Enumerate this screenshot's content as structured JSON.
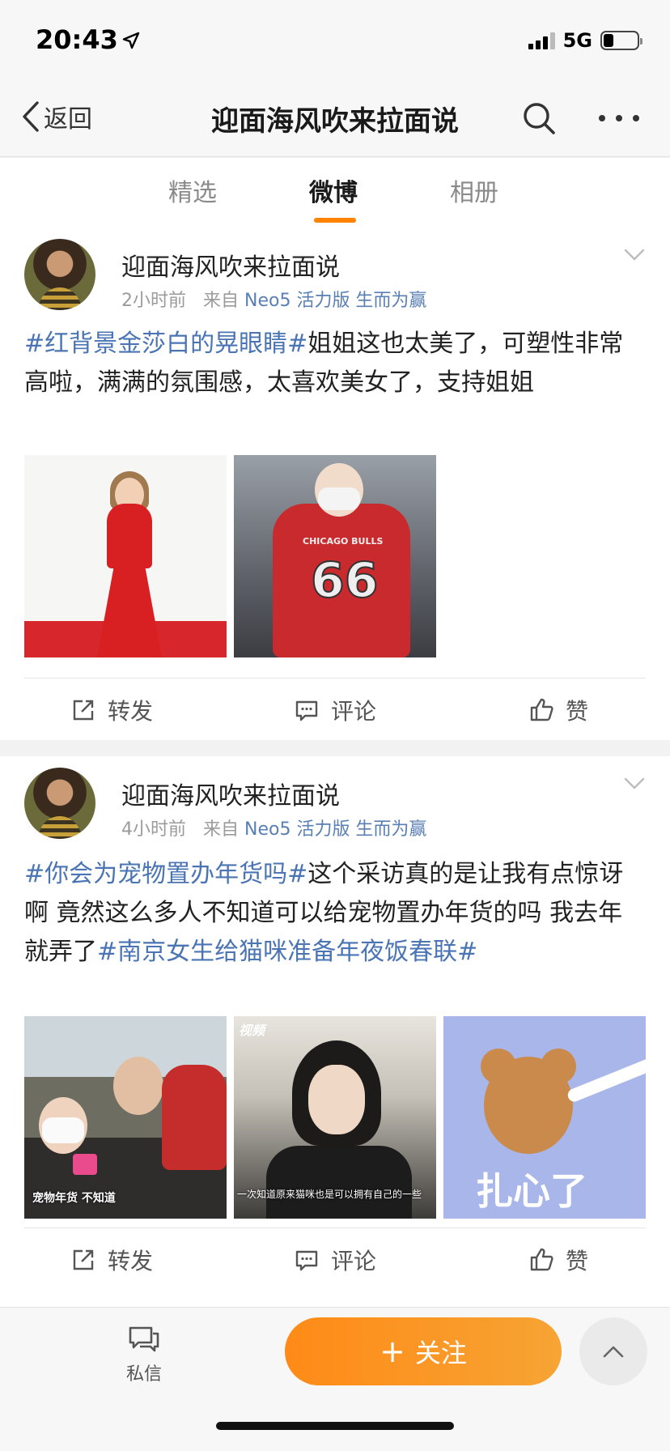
{
  "status_bar": {
    "time": "20:43",
    "network": "5G"
  },
  "nav": {
    "back_label": "返回",
    "title": "迎面海风吹来拉面说"
  },
  "tabs": [
    {
      "label": "精选",
      "active": false
    },
    {
      "label": "微博",
      "active": true
    },
    {
      "label": "相册",
      "active": false
    }
  ],
  "posts": [
    {
      "author": "迎面海风吹来拉面说",
      "time": "2小时前",
      "source_prefix": "来自",
      "source": "Neo5 活力版 生而为赢",
      "text_parts": [
        {
          "type": "hashtag",
          "text": "#红背景金莎白的晃眼睛#"
        },
        {
          "type": "text",
          "text": "姐姐这也太美了，可塑性非常高啦，满满的氛围感，太喜欢美女了，支持姐姐"
        }
      ],
      "actions": {
        "repost": "转发",
        "comment": "评论",
        "like": "赞"
      }
    },
    {
      "author": "迎面海风吹来拉面说",
      "time": "4小时前",
      "source_prefix": "来自",
      "source": "Neo5 活力版 生而为赢",
      "text_parts": [
        {
          "type": "hashtag",
          "text": "#你会为宠物置办年货吗#"
        },
        {
          "type": "text",
          "text": "这个采访真的是让我有点惊讶啊 竟然这么多人不知道可以给宠物置办年货的吗 我去年就弄了"
        },
        {
          "type": "hashtag",
          "text": "#南京女生给猫咪准备年夜饭春联#"
        }
      ],
      "images": [
        {
          "caption": "宠物年货 不知道"
        },
        {
          "tag": "视频",
          "caption": "一次知道原来猫咪也是可以拥有自己的一些"
        },
        {
          "caption": "扎心了"
        }
      ],
      "actions": {
        "repost": "转发",
        "comment": "评论",
        "like": "赞"
      }
    }
  ],
  "bottom_bar": {
    "dm_label": "私信",
    "follow_label": "关注",
    "follow_plus": "+"
  },
  "colors": {
    "accent": "#ff8200",
    "hashtag": "#4a74b3",
    "follow_start": "#ff8a17",
    "follow_end": "#f6a434"
  },
  "icons": [
    "location-arrow-icon",
    "signal-icon",
    "battery-icon",
    "back-chevron-icon",
    "search-icon",
    "more-icon",
    "chevron-down-icon",
    "repost-icon",
    "comment-icon",
    "like-icon",
    "message-icon",
    "chevron-up-icon"
  ]
}
